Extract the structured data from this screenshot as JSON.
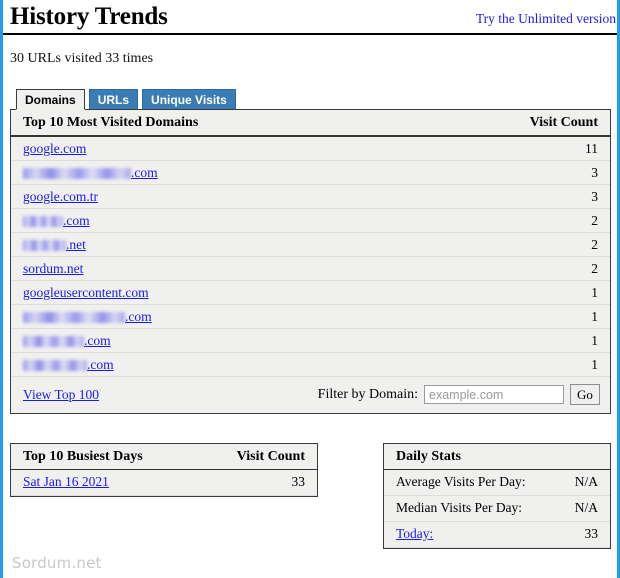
{
  "header": {
    "title": "History Trends",
    "unlimited_link": "Try the Unlimited version",
    "summary": "30 URLs visited 33 times"
  },
  "tabs": [
    {
      "label": "Domains",
      "active": true
    },
    {
      "label": "URLs",
      "active": false
    },
    {
      "label": "Unique Visits",
      "active": false
    }
  ],
  "domains_panel": {
    "col_domain": "Top 10 Most Visited Domains",
    "col_count": "Visit Count",
    "rows": [
      {
        "domain": "google.com",
        "redacted": false,
        "suffix": "",
        "count": "11"
      },
      {
        "domain": "",
        "redacted": true,
        "redacted_width": 108,
        "suffix": ".com",
        "count": "3"
      },
      {
        "domain": "google.com.tr",
        "redacted": false,
        "suffix": "",
        "count": "3"
      },
      {
        "domain": "",
        "redacted": true,
        "redacted_width": 40,
        "suffix": ".com",
        "count": "2"
      },
      {
        "domain": "",
        "redacted": true,
        "redacted_width": 43,
        "suffix": ".net",
        "count": "2"
      },
      {
        "domain": "sordum.net",
        "redacted": false,
        "suffix": "",
        "count": "2"
      },
      {
        "domain": "googleusercontent.com",
        "redacted": false,
        "suffix": "",
        "count": "1"
      },
      {
        "domain": "",
        "redacted": true,
        "redacted_width": 102,
        "suffix": ".com",
        "count": "1"
      },
      {
        "domain": "",
        "redacted": true,
        "redacted_width": 61,
        "suffix": ".com",
        "count": "1"
      },
      {
        "domain": "",
        "redacted": true,
        "redacted_width": 64,
        "suffix": ".com",
        "count": "1"
      }
    ],
    "view_top_link": "View Top 100",
    "filter_label": "Filter by Domain:",
    "filter_value": "",
    "filter_placeholder": "example.com",
    "go_button": "Go"
  },
  "busiest_panel": {
    "col_day": "Top 10 Busiest Days",
    "col_count": "Visit Count",
    "rows": [
      {
        "day": "Sat Jan 16 2021",
        "count": "33"
      }
    ]
  },
  "daily_stats": {
    "title": "Daily Stats",
    "rows": [
      {
        "label": "Average Visits Per Day:",
        "value": "N/A",
        "link": false
      },
      {
        "label": "Median Visits Per Day:",
        "value": "N/A",
        "link": false
      },
      {
        "label": "Today:",
        "value": "33",
        "link": true
      }
    ]
  },
  "watermark": "Sordum.net",
  "colors": {
    "accent_blue": "#1f9cf0",
    "tab_blue": "#3c7cb4",
    "link_blue": "#1a1af0",
    "panel_bg": "#f0f0ef",
    "watermark_gray": "#c8c8c8"
  }
}
